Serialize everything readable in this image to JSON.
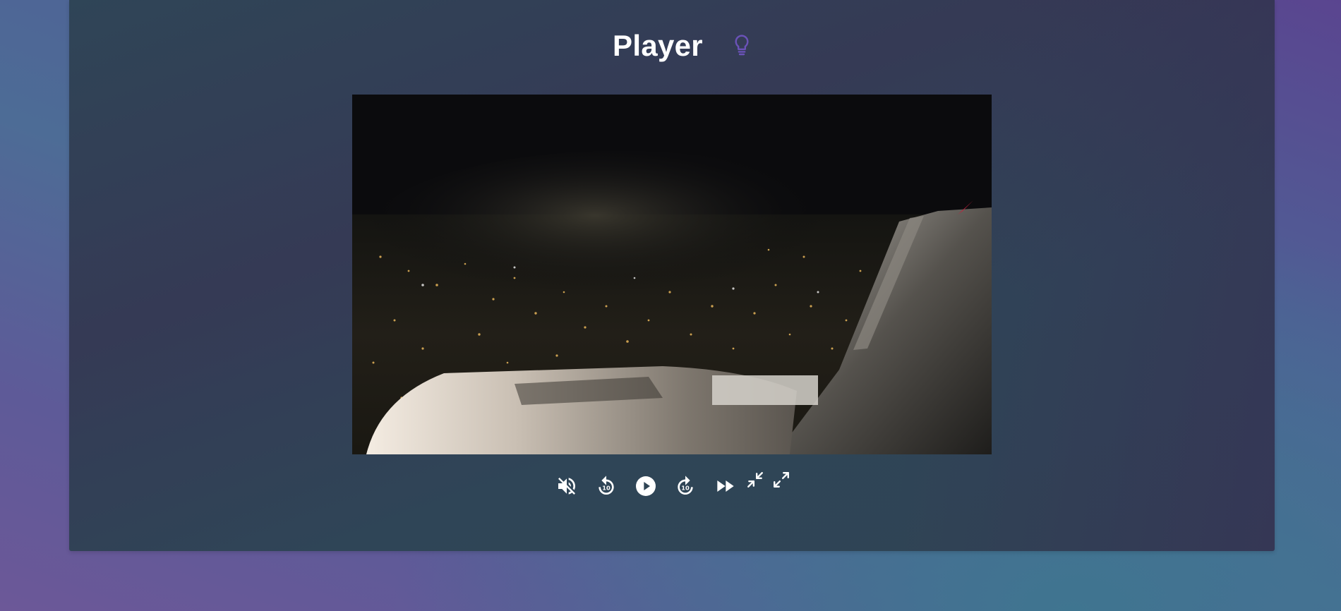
{
  "player": {
    "title": "Player"
  },
  "icons": {
    "theme_toggle": "lightbulb-icon",
    "mute": "volume-off-icon",
    "rewind": "replay-10-icon",
    "play": "play-circle-icon",
    "forward": "forward-10-icon",
    "fast_forward": "fast-forward-icon",
    "exit_fullscreen": "fullscreen-exit-icon",
    "fullscreen": "fullscreen-icon"
  },
  "colors": {
    "accent": "#6a52b8",
    "title": "#ffffff",
    "controls": "#ffffff"
  }
}
